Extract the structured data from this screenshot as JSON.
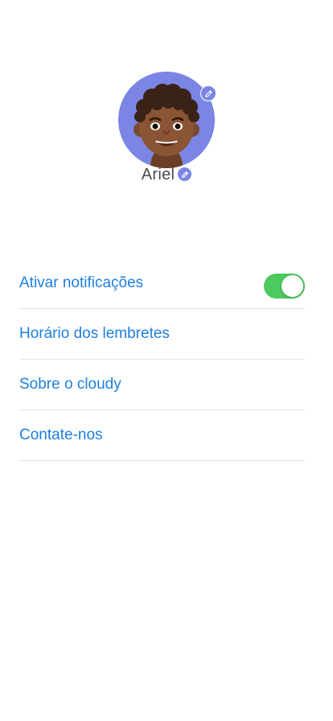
{
  "profile": {
    "name": "Ariel",
    "avatar_icon": "memoji-avatar",
    "edit_icon": "pencil-icon",
    "accent_color": "#7b85e3"
  },
  "menu": {
    "items": [
      {
        "label": "Ativar notificações",
        "has_toggle": true,
        "toggle_on": true
      },
      {
        "label": "Horário dos lembretes"
      },
      {
        "label": "Sobre o cloudy"
      },
      {
        "label": "Contate-nos"
      }
    ],
    "link_color": "#1e7fe0",
    "toggle_color": "#4cca5e"
  }
}
